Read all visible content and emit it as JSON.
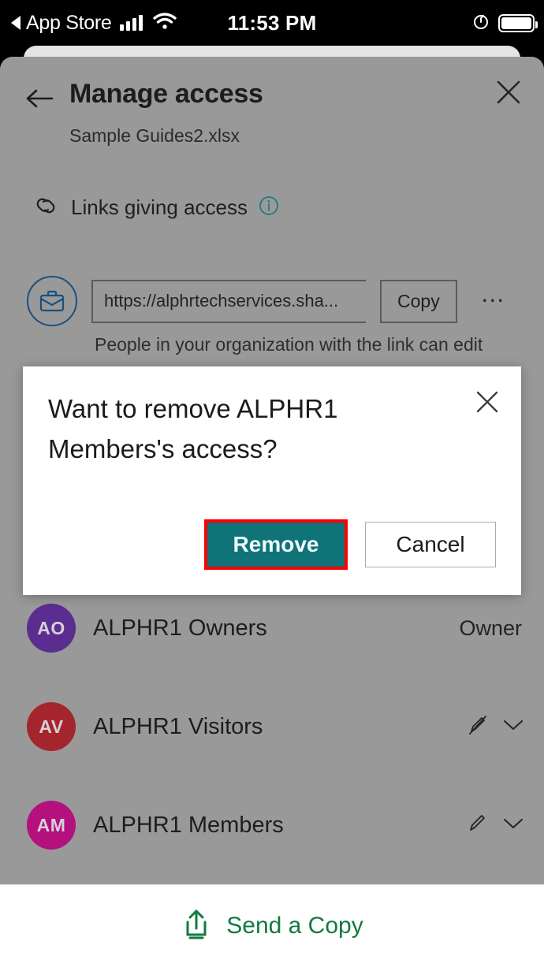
{
  "status_bar": {
    "back_app": "App Store",
    "back_icon": "back-triangle-icon",
    "signal_icon": "cellular-signal-icon",
    "wifi_icon": "wifi-icon",
    "time": "11:53 PM",
    "orientation_lock_icon": "rotation-lock-icon",
    "battery_icon": "battery-full-icon"
  },
  "header": {
    "back_icon": "back-arrow-icon",
    "title": "Manage access",
    "subtitle": "Sample Guides2.xlsx",
    "close_icon": "close-icon"
  },
  "links_section": {
    "chain_icon": "link-chain-icon",
    "label": "Links giving access",
    "info_icon": "info-circle-icon",
    "info_color": "#1a7d82"
  },
  "link_item": {
    "scope_icon": "briefcase-icon",
    "url": "https://alphrtechservices.sha...",
    "copy_label": "Copy",
    "more_icon": "more-horizontal-icon",
    "description": "People in your organization with the link can edit"
  },
  "people": [
    {
      "initials": "AO",
      "name": "ALPHR1 Owners",
      "role": "Owner",
      "avatar_color": "#5c2d91",
      "actions": []
    },
    {
      "initials": "AV",
      "name": "ALPHR1 Visitors",
      "role": "",
      "avatar_color": "#a4262c",
      "actions": [
        "pencil-slash-icon",
        "chevron-down-icon"
      ]
    },
    {
      "initials": "AM",
      "name": "ALPHR1 Members",
      "role": "",
      "avatar_color": "#b4117e",
      "actions": [
        "pencil-icon",
        "chevron-down-icon"
      ]
    }
  ],
  "bottom_bar": {
    "share_icon": "share-upload-icon",
    "label": "Send a Copy",
    "color": "#137a3e"
  },
  "dialog": {
    "title": "Want to remove ALPHR1 Members's access?",
    "close_icon": "close-icon",
    "remove_label": "Remove",
    "cancel_label": "Cancel",
    "remove_color": "#0f7378",
    "highlight_color": "#ff0000"
  }
}
